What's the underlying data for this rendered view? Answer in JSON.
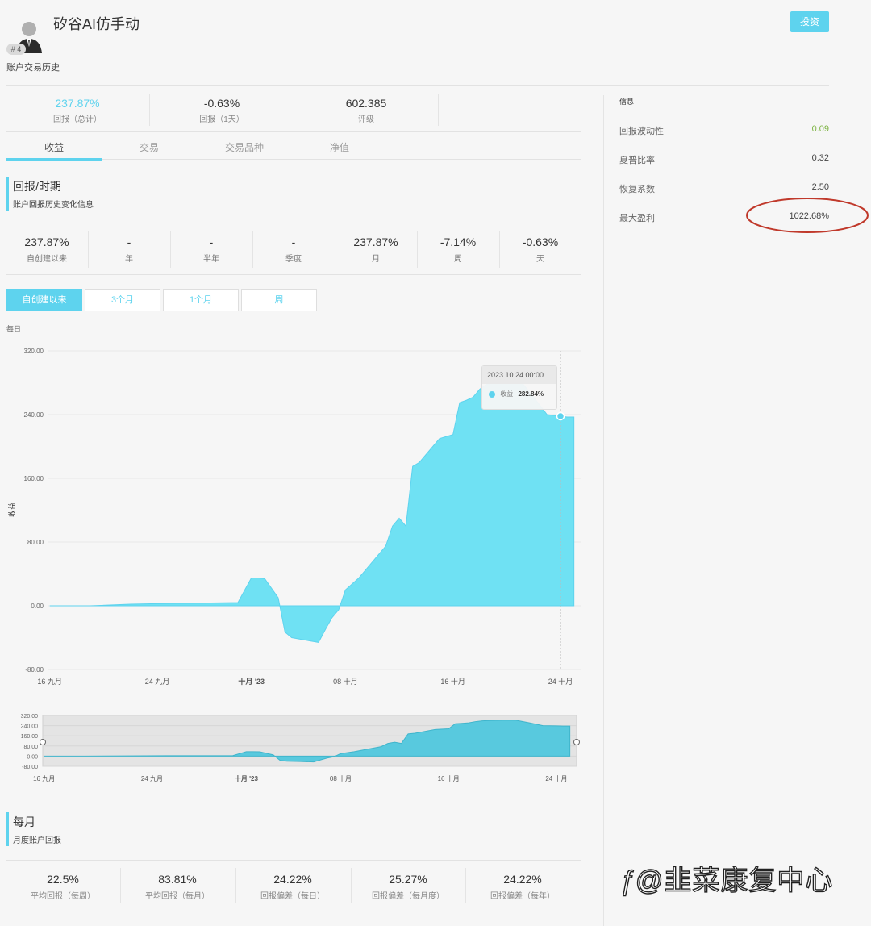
{
  "header": {
    "account_name": "矽谷AI仿手动",
    "badge": "# 4",
    "subtitle": "账户交易历史",
    "invest_label": "投资"
  },
  "summary": [
    {
      "value": "237.87%",
      "label": "回报（总计）",
      "highlight": true
    },
    {
      "value": "-0.63%",
      "label": "回报（1天）"
    },
    {
      "value": "602.385",
      "label": "评级"
    }
  ],
  "tabs": [
    "收益",
    "交易",
    "交易品种",
    "净值"
  ],
  "returns_section": {
    "title": "回报/时期",
    "subtitle": "账户回报历史变化信息"
  },
  "periods": [
    {
      "value": "237.87%",
      "label": "自创建以来"
    },
    {
      "value": "-",
      "label": "年"
    },
    {
      "value": "-",
      "label": "半年"
    },
    {
      "value": "-",
      "label": "季度"
    },
    {
      "value": "237.87%",
      "label": "月"
    },
    {
      "value": "-7.14%",
      "label": "周"
    },
    {
      "value": "-0.63%",
      "label": "天"
    }
  ],
  "range_buttons": [
    "自创建以来",
    "3个月",
    "1个月",
    "周"
  ],
  "chart_caption": "每日",
  "tooltip": {
    "date": "2023.10.24 00:00",
    "series": "收益",
    "value": "282.84%"
  },
  "chart_data": {
    "type": "area",
    "ylabel": "收益",
    "ylim": [
      -80,
      320
    ],
    "y_ticks": [
      "320.00",
      "240.00",
      "160.00",
      "80.00",
      "0.00",
      "-80.00"
    ],
    "x_ticks": [
      "16 九月",
      "24 九月",
      "十月 '23",
      "08 十月",
      "16 十月",
      "24 十月"
    ],
    "x_start": "2023-09-16",
    "series": [
      {
        "name": "收益",
        "x": [
          "2023-09-16",
          "2023-09-19",
          "2023-09-22",
          "2023-09-25",
          "2023-09-28",
          "2023-09-30",
          "2023-10-01",
          "2023-10-01 12:00",
          "2023-10-02",
          "2023-10-03",
          "2023-10-03 12:00",
          "2023-10-04",
          "2023-10-05",
          "2023-10-06",
          "2023-10-06 12:00",
          "2023-10-07",
          "2023-10-07 12:00",
          "2023-10-08",
          "2023-10-09",
          "2023-10-10",
          "2023-10-11",
          "2023-10-11 12:00",
          "2023-10-12",
          "2023-10-12 12:00",
          "2023-10-13",
          "2023-10-13 12:00",
          "2023-10-14",
          "2023-10-15",
          "2023-10-16",
          "2023-10-16 12:00",
          "2023-10-17",
          "2023-10-17 12:00",
          "2023-10-18",
          "2023-10-18 12:00",
          "2023-10-19",
          "2023-10-20",
          "2023-10-21",
          "2023-10-22",
          "2023-10-23",
          "2023-10-24",
          "2023-10-24 12:00",
          "2023-10-25"
        ],
        "values": [
          0,
          0,
          2,
          3,
          3.5,
          4,
          35,
          35,
          34,
          10,
          -33,
          -40,
          -43,
          -46,
          -30,
          -15,
          -5,
          20,
          35,
          55,
          75,
          100,
          110,
          100,
          175,
          180,
          190,
          210,
          215,
          255,
          258,
          262,
          272,
          278,
          280,
          283,
          282.84,
          262,
          240,
          238,
          237,
          237
        ]
      }
    ]
  },
  "navigator": {
    "y_ticks": [
      "320.00",
      "240.00",
      "160.00",
      "80.00",
      "0.00",
      "-80.00"
    ],
    "x_ticks": [
      "16 九月",
      "24 九月",
      "十月 '23",
      "08 十月",
      "16 十月",
      "24 十月"
    ]
  },
  "info": {
    "title": "信息",
    "rows": [
      {
        "label": "回报波动性",
        "value": "0.09",
        "color": "#7cb342"
      },
      {
        "label": "夏普比率",
        "value": "0.32"
      },
      {
        "label": "恢复系数",
        "value": "2.50"
      },
      {
        "label": "最大盈利",
        "value": "1022.68%",
        "circled": true
      }
    ]
  },
  "monthly_section": {
    "title": "每月",
    "subtitle": "月度账户回报"
  },
  "monthly": [
    {
      "value": "22.5%",
      "label": "平均回报（每周）"
    },
    {
      "value": "83.81%",
      "label": "平均回报（每月）"
    },
    {
      "value": "24.22%",
      "label": "回报偏差（每日）"
    },
    {
      "value": "25.27%",
      "label": "回报偏差（每月度）"
    },
    {
      "value": "24.22%",
      "label": "回报偏差（每年）"
    }
  ],
  "watermark": "@韭菜康复中心",
  "colors": {
    "accent": "#5ed3ee",
    "area": "#6fe1f3",
    "circle": "#c0392b"
  }
}
